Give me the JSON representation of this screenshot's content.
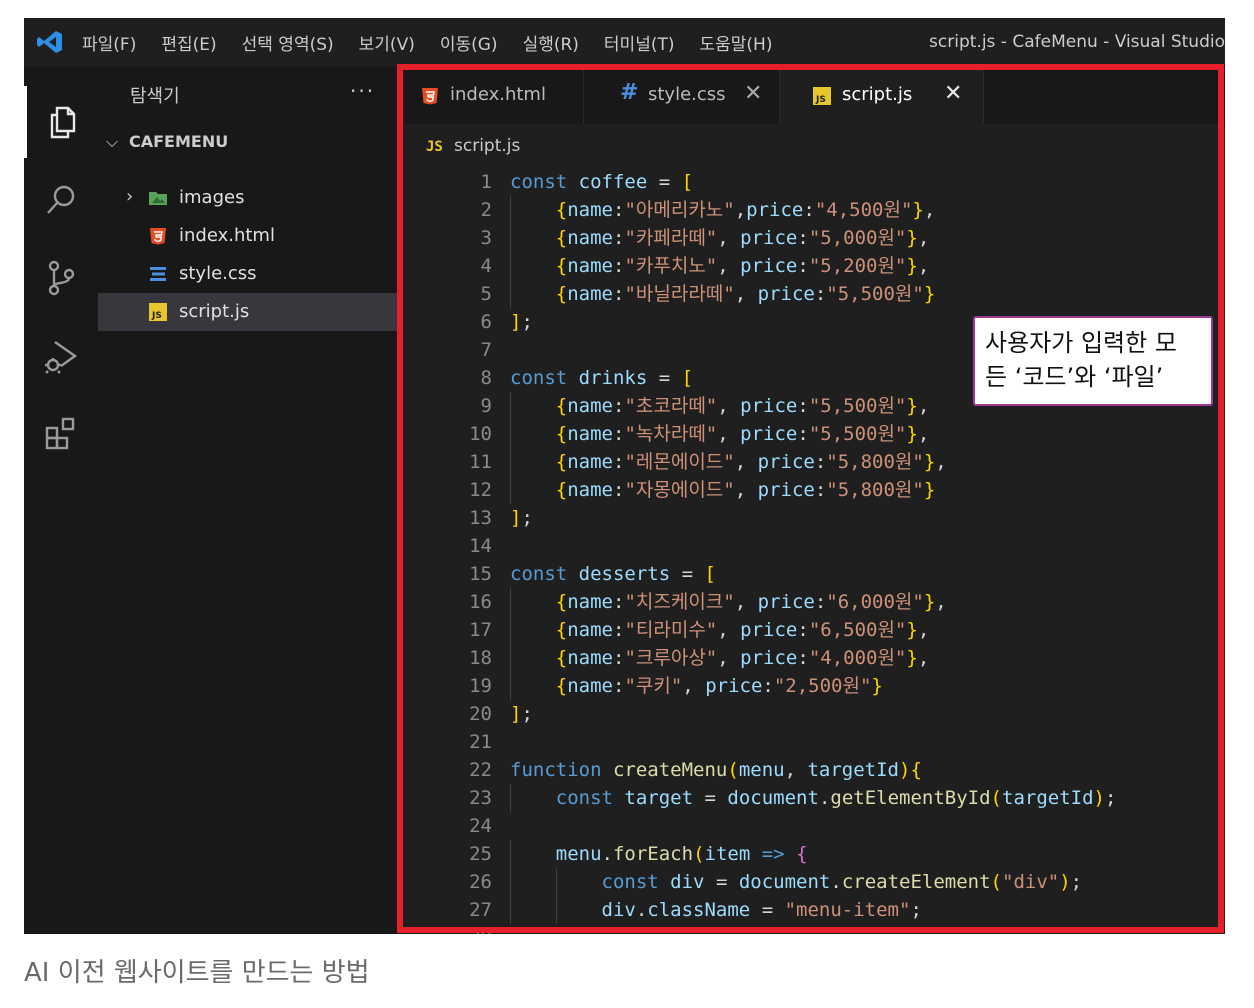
{
  "titlebar": {
    "menus": [
      "파일(F)",
      "편집(E)",
      "선택 영역(S)",
      "보기(V)",
      "이동(G)",
      "실행(R)",
      "터미널(T)",
      "도움말(H)"
    ],
    "window_title": "script.js - CafeMenu - Visual Studio"
  },
  "sidebar": {
    "title": "탐색기",
    "more": "···",
    "folder": "CAFEMENU",
    "items": [
      {
        "label": "images",
        "icon": "folder-image-icon"
      },
      {
        "label": "index.html",
        "icon": "html-file-icon"
      },
      {
        "label": "style.css",
        "icon": "css-file-icon"
      },
      {
        "label": "script.js",
        "icon": "js-file-icon"
      }
    ]
  },
  "tabs": [
    {
      "label": "index.html",
      "icon": "html-file-icon",
      "active": false
    },
    {
      "label": "style.css",
      "icon": "css-hash-icon",
      "active": false
    },
    {
      "label": "script.js",
      "icon": "js-file-icon",
      "active": true
    }
  ],
  "breadcrumb": {
    "icon_text": "JS",
    "label": "script.js"
  },
  "code_lines": [
    "const coffee = [",
    "    {name:\"아메리카노\",price:\"4,500원\"},",
    "    {name:\"카페라떼\", price:\"5,000원\"},",
    "    {name:\"카푸치노\", price:\"5,200원\"},",
    "    {name:\"바닐라라떼\", price:\"5,500원\"}",
    "];",
    "",
    "const drinks = [",
    "    {name:\"초코라떼\", price:\"5,500원\"},",
    "    {name:\"녹차라떼\", price:\"5,500원\"},",
    "    {name:\"레몬에이드\", price:\"5,800원\"},",
    "    {name:\"자몽에이드\", price:\"5,800원\"}",
    "];",
    "",
    "const desserts = [",
    "    {name:\"치즈케이크\", price:\"6,000원\"},",
    "    {name:\"티라미수\", price:\"6,500원\"},",
    "    {name:\"크루아상\", price:\"4,000원\"},",
    "    {name:\"쿠키\", price:\"2,500원\"}",
    "];",
    "",
    "function createMenu(menu, targetId){",
    "    const target = document.getElementById(targetId);",
    "",
    "    menu.forEach(item => {",
    "        const div = document.createElement(\"div\");",
    "        div.className = \"menu-item\";",
    ""
  ],
  "callout": {
    "line1": "사용자가 입력한 모",
    "line2": "든 ‘코드’와 ‘파일’"
  },
  "caption": "AI 이전 웹사이트를 만드는 방법",
  "colors": {
    "highlight": "#e5202a",
    "callout_border": "#a03a9a",
    "keyword": "#569cd6",
    "string": "#ce9178",
    "variable": "#9cdcfe",
    "function": "#dcdcaa"
  }
}
